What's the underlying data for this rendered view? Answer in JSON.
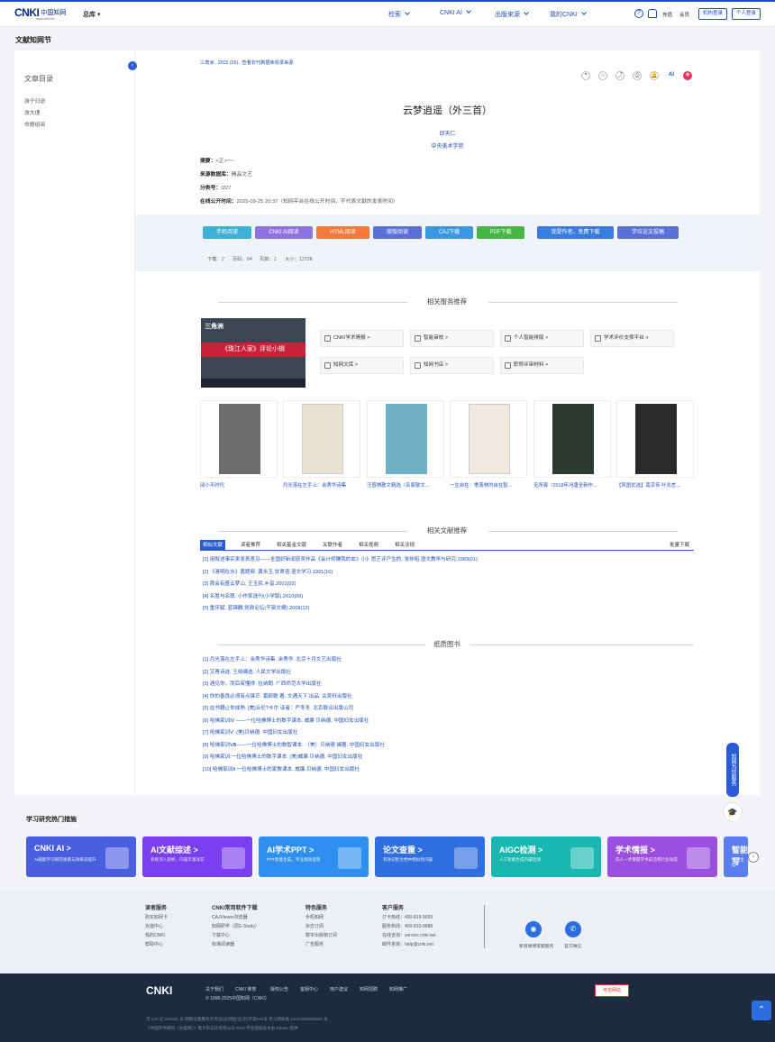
{
  "header": {
    "logo_main": "CNKI",
    "logo_cn": "中国知网",
    "logo_url": "www.cnki.net",
    "library": "总库",
    "nav": [
      "检索",
      "CNKI AI",
      "出版来源",
      "我的CNKI"
    ],
    "help_icon": "?",
    "recharge": "充值",
    "member": "会员",
    "org_login": "机构登录",
    "personal_login": "个人登录"
  },
  "brand_title": "文献知网节",
  "toc": {
    "title": "文章目录",
    "items": [
      "游子归途",
      "游大理",
      "命题组阅"
    ]
  },
  "article": {
    "crumb": "三角洲 . 2025 (26) . 查看非刊数据库收录来源",
    "tools": [
      "❝",
      "☆",
      "⤴",
      "⎙",
      "🔔",
      "AI",
      "◈"
    ],
    "title": "云梦逍遥（外三首）",
    "author": "邱天仁",
    "institution": "中央美术学院",
    "abstract_label": "摘要：",
    "abstract": "<正>一-",
    "source_db_label": "来源数据库：",
    "source_db": "精品文艺",
    "classno_label": "分类号：",
    "classno": "I227",
    "online_label": "在线公开时间：",
    "online": "2025-09-25 20:37（知网平台在线公开时间，不代表文献的发表时间）"
  },
  "download_buttons": [
    {
      "label": "手机阅读",
      "color": "#3fb0d6"
    },
    {
      "label": "CNKI AI阅读",
      "color": "#8f74e0"
    },
    {
      "label": "HTML阅读",
      "color": "#f27a3c"
    },
    {
      "label": "原版阅读",
      "color": "#5b70d6"
    },
    {
      "label": "CAJ下载",
      "color": "#3a98e0"
    },
    {
      "label": "PDF下载",
      "color": "#49b544"
    },
    {
      "label": "我是作者，免费下载",
      "color": "#3a7be0"
    },
    {
      "label": "学位论文投稿",
      "color": "#5b6fd8"
    }
  ],
  "stats": {
    "download": "下载：2",
    "pages": "页码：64",
    "page_count": "页数：1",
    "size": "大小：1272K"
  },
  "related_services": {
    "title": "相关服务推荐",
    "ad_top": "三角洲",
    "ad_banner": "《珠江人家》评论小辑",
    "items": [
      "CNKI学术情报 >",
      "智能审校 >",
      "个人智能排版 >",
      "学术评价支撑平台 >",
      "知网文库 >",
      "知网书店 >",
      "职称评审材料 >"
    ]
  },
  "books": [
    {
      "caption": "邱小平时代",
      "color": "#6c6c6c"
    },
    {
      "caption": "月光落在左手上：余秀华诗集",
      "color": "#e9e2d4"
    },
    {
      "caption": "汪曾祺散文精选（名家散文...",
      "color": "#6fb0c7"
    },
    {
      "caption": "一生自在：季羡林的自在智...",
      "color": "#efe9e0"
    },
    {
      "caption": "无所畏（2018年冯唐全新作...",
      "color": "#2d3a2f"
    },
    {
      "caption": "【凤凰优选】南京传 叶兆言...",
      "color": "#2a2a2a"
    }
  ],
  "related_literature": {
    "title": "相关文献推荐",
    "tabs": [
      "相似文献",
      "读者推荐",
      "相关基金文献",
      "关联作者",
      "相关视频",
      "相关法规"
    ],
    "batch": "批量下载",
    "refs": [
      "[1] 用叙述事实来发表意见——全国好新闻获奖作品《会计师赚我的血》小》思艺评产生的. 张仲昭.语文教学与研究.1983(01)",
      "[2] 《清明在水》嘉题频. 黄永玉.甘肃语.语文学习.1991(10)",
      "[3] 那会有盛云梦山. 王玉民.乡音.2001(02)",
      "[4] 名胜与名联. 小作家选刊(小学版).2010(06)",
      "[5] 重庆赋. 蓝锦麟.党政论坛(干部文摘).2008(12)"
    ]
  },
  "paper_books": {
    "title": "纸质图书",
    "refs": [
      "[1] 月光落在左手上：余秀华诗集. 余秀华. 北京十月文艺出版社",
      "[2] 艾青诗选. 王晓编选. 人民文学出版社",
      "[3] 遇见你，而后有懂得. 拉纳朗. 广西师范大学出版社",
      "[4] 你的善良必须有点锋芒. 慕颜歌 著. 文通天下 出品. 古吴轩出版社",
      "[5] 在书籍让你成熟. [美]丘伦?卡尔 译者：严冬冬. 北京联合出版公司",
      "[6] 哈佛家训Ⅳ ——一位哈佛博士的数字课本. 威廉 贝纳德. 中国妇女出版社",
      "[7] 哈佛家训Ⅴ. (美)贝纳德. 中国妇女出版社",
      "[8] 哈佛家训Ⅷ——一位哈佛博士的数智课本. （美）贝纳德 编著. 中国妇女出版社",
      "[9] 哈佛家训:一位哈佛博士的数字课本. (美)威廉.贝纳德. 中国妇女出版社",
      "[10] 哈佛家训Ⅱ:一位哈佛博士的家教课本. 威廉.贝纳德. 中国妇女出版社"
    ]
  },
  "float": {
    "tab": "知网为您服务",
    "icon": "🎓"
  },
  "hot": {
    "title": "学习研究热门措施",
    "cards": [
      {
        "title": "CNKI AI  >",
        "sub": "AI赋能学习研究质量与效率双提升",
        "color": "#4a5fe0"
      },
      {
        "title": "AI文献综述  >",
        "sub": "系统深入剖析，内容丰富详实",
        "color": "#7a3ff0"
      },
      {
        "title": "AI学术PPT  >",
        "sub": "PPT智能生成，专业高效呈现",
        "color": "#2f8ff0"
      },
      {
        "title": "论文查重  >",
        "sub": "有效识别文档中相似性内容",
        "color": "#2f6fe0"
      },
      {
        "title": "AIGC检测  >",
        "sub": "人工智能生成内容检测",
        "color": "#19b7b0"
      },
      {
        "title": "学术情报  >",
        "sub": "先人一步掌握学术前沿和行业动态",
        "color": "#9a4fe0"
      },
      {
        "title": "智能写",
        "sub": "智能生成",
        "color": "#5b7ef0"
      }
    ]
  },
  "footer": {
    "cols": [
      {
        "head": "读者服务",
        "items": [
          "购买知网卡",
          "充值中心",
          "我的CNKI",
          "帮助中心"
        ]
      },
      {
        "head": "CNKI常用软件下载",
        "items": [
          "CAJViewer浏览器",
          "知网研学（原E-Study）",
          "下载中心",
          "标准阅读器"
        ]
      },
      {
        "head": "特色服务",
        "items": [
          "手机知网",
          "杂志订阅",
          "数字出版物订阅",
          "广告服务"
        ]
      },
      {
        "head": "客户服务",
        "items": [
          "订卡热线：400-819-9993",
          "服务热线：400-810-9888",
          "在线咨询：service.cnki.net",
          "邮件咨询：help@cnki.net"
        ]
      }
    ],
    "weibo": "新浪微博客服服务",
    "wechat": "官方微信",
    "links": [
      "关于我们",
      "CNKI 荣誉",
      "版权公告",
      "客服中心",
      "用户建议",
      "知网招聘",
      "知网推广"
    ],
    "copyright": "© 1998-2025中国知网（CNKI）",
    "icp": "京 ICP 证 040431 号  网络出版服务许可证(总)网出证(京)字第416号  京公网安备 11010802020460 号",
    "company": "《中国学术期刊（光盘版）》电子杂志社有限公司  KDN 平台基础技术由 KBase 提供",
    "safe_badge": "可信网站"
  },
  "totop": "⌃"
}
